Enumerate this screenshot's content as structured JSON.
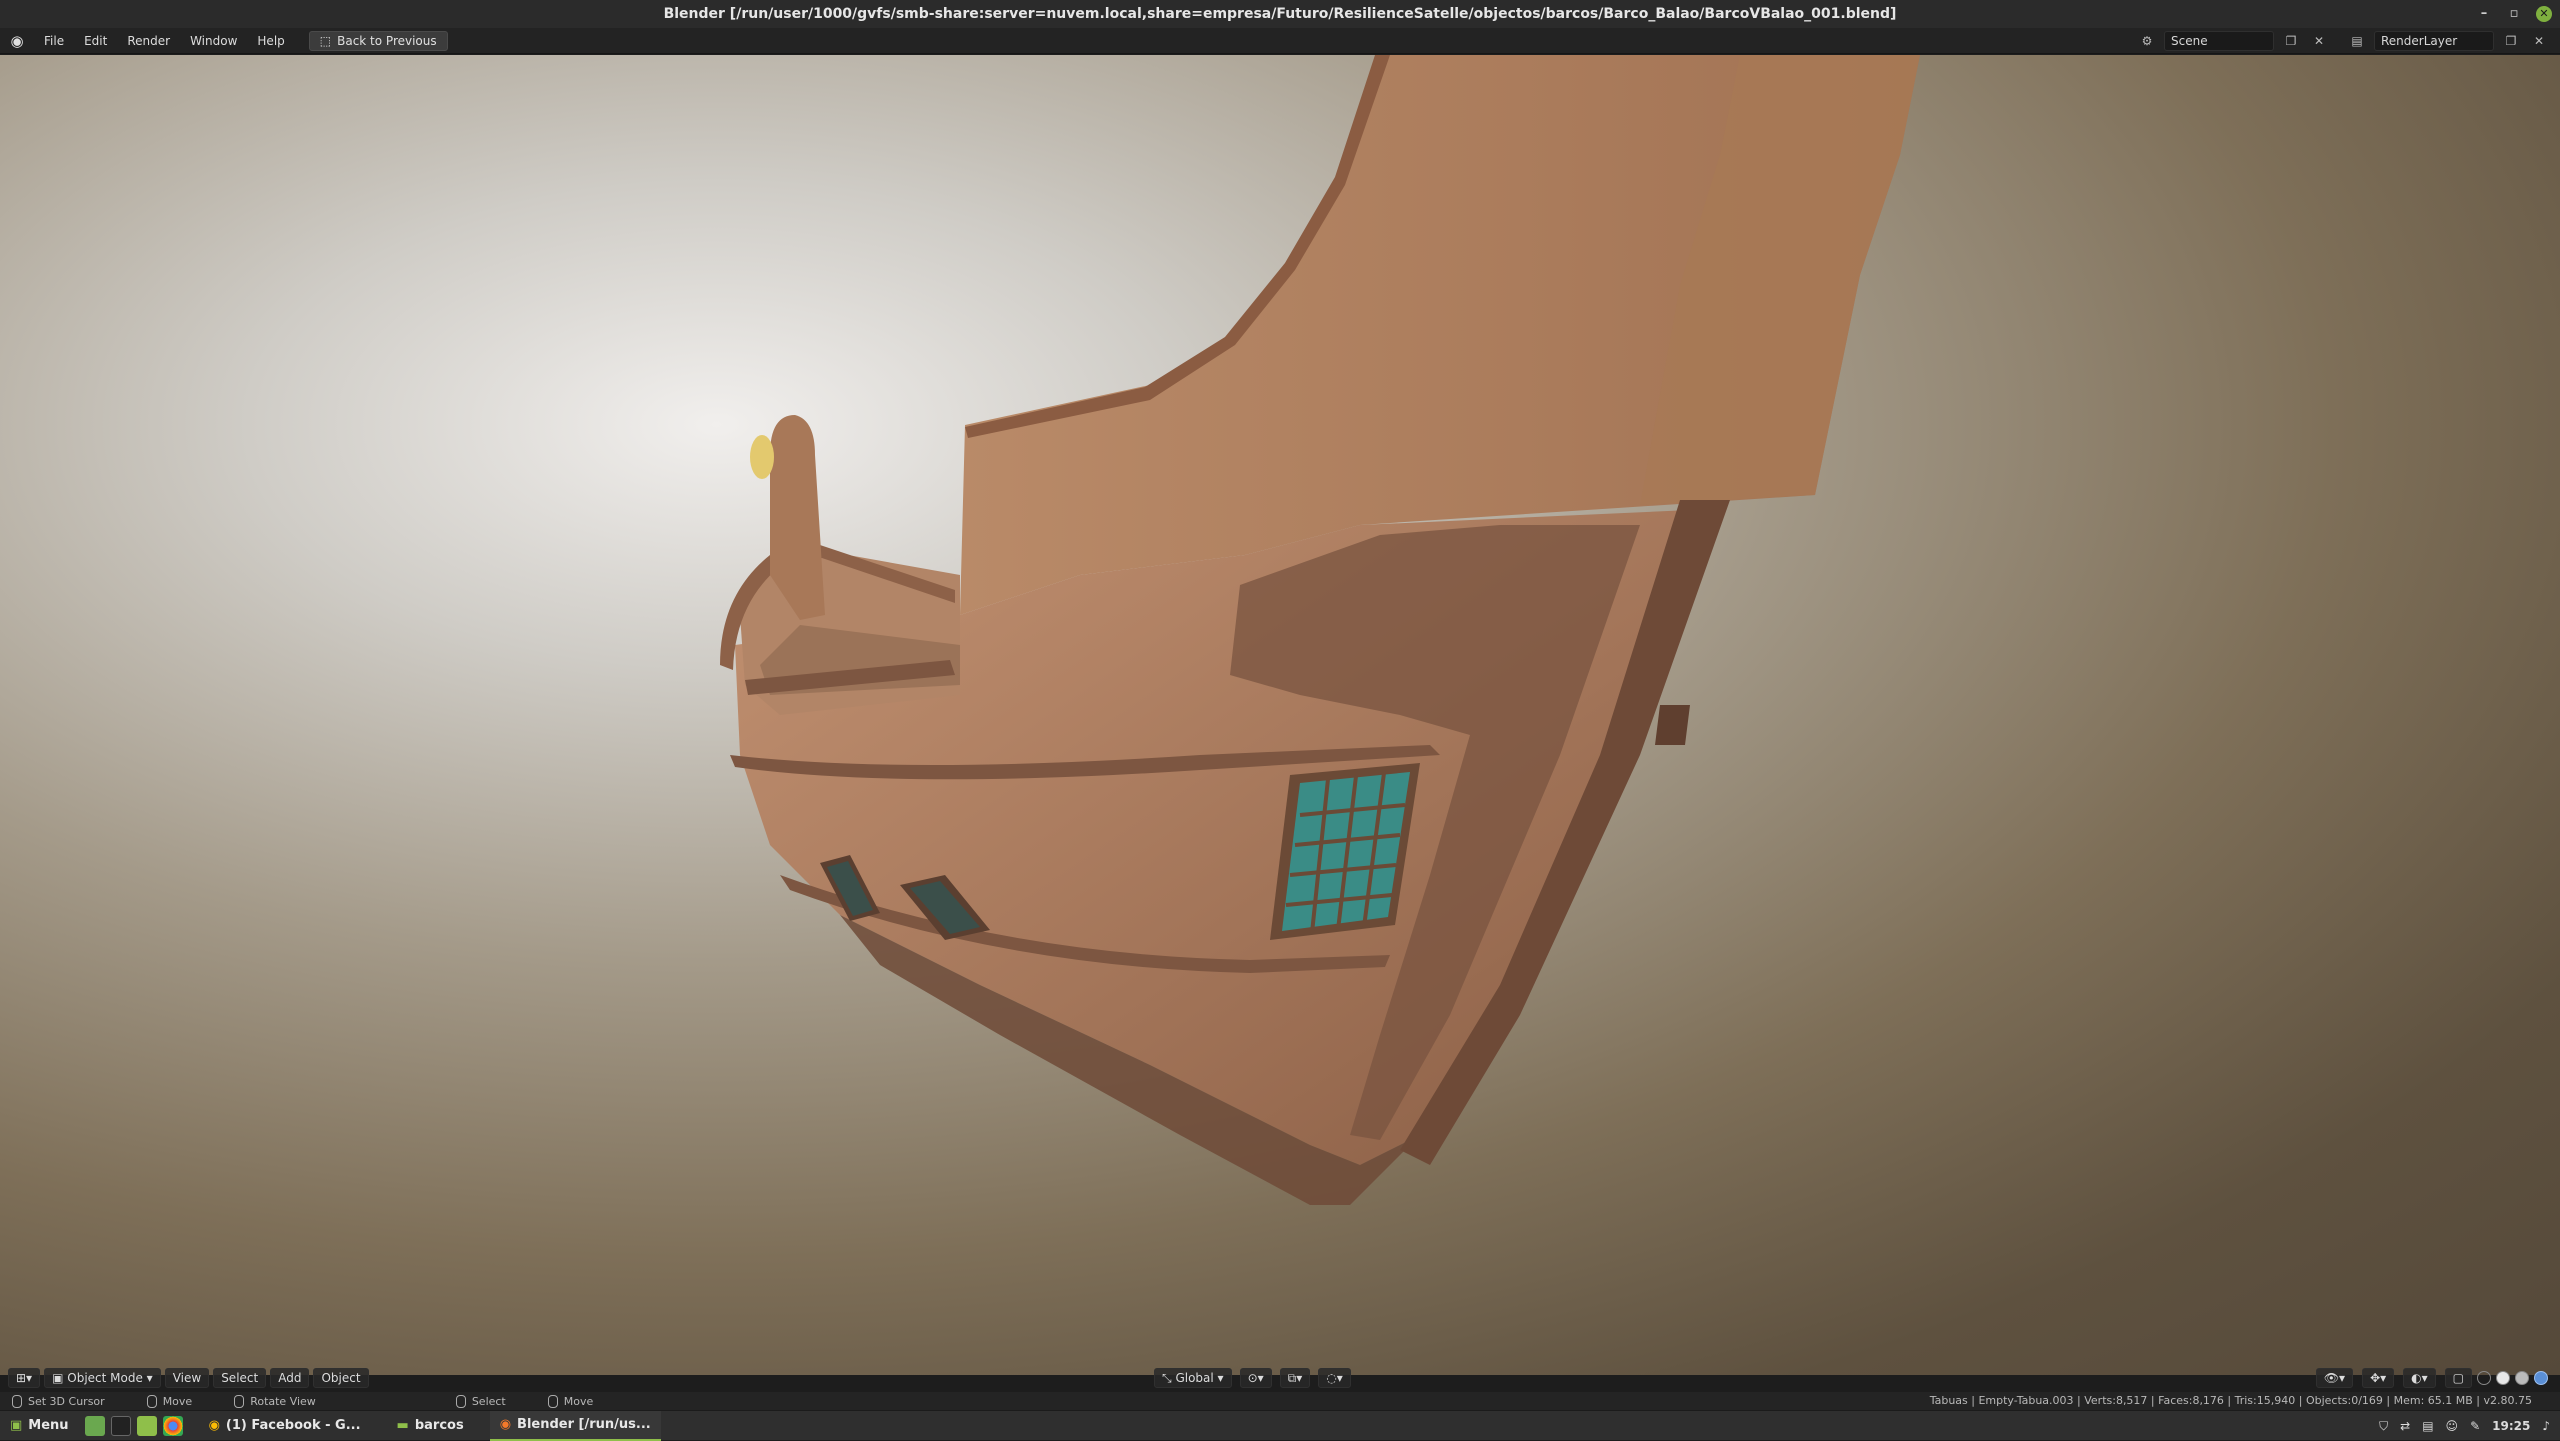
{
  "window": {
    "title": "Blender [/run/user/1000/gvfs/smb-share:server=nuvem.local,share=empresa/Futuro/ResilienceSatelle/objectos/barcos/Barco_Balao/BarcoVBalao_001.blend]",
    "minimize": "–",
    "maximize": "▫",
    "close": "✕"
  },
  "menubar": {
    "items": [
      "File",
      "Edit",
      "Render",
      "Window",
      "Help"
    ],
    "back_label": "Back to Previous",
    "scene": "Scene",
    "render_layer": "RenderLayer"
  },
  "viewport_header": {
    "mode": "Object Mode",
    "menus": [
      "View",
      "Select",
      "Add",
      "Object"
    ],
    "orientation": "Global"
  },
  "statusbar": {
    "hints": [
      "Set 3D Cursor",
      "Move",
      "Rotate View",
      "Select",
      "Move"
    ],
    "stats": "Tabuas | Empty-Tabua.003 | Verts:8,517 | Faces:8,176 | Tris:15,940 | Objects:0/169 | Mem: 65.1 MB | v2.80.75"
  },
  "taskbar": {
    "menu_label": "Menu",
    "tasks": [
      "(1) Facebook - G...",
      "barcos",
      "Blender [/run/us..."
    ],
    "clock": "19:25"
  },
  "colors": {
    "hull": "#b0805f",
    "hull_shadow": "#7a5440",
    "window_glass": "#3a8c86",
    "accent": "#8fbf4a"
  }
}
